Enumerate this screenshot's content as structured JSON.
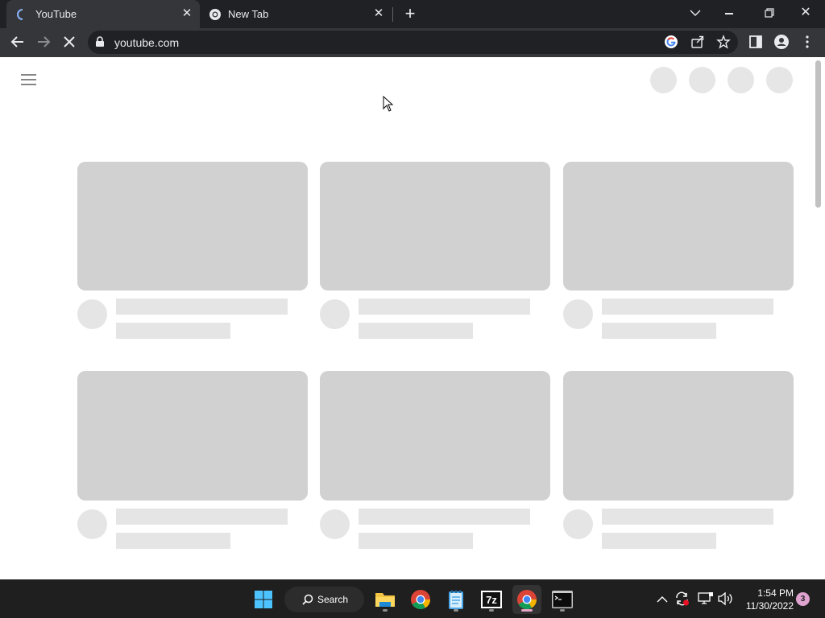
{
  "browser": {
    "tabs": [
      {
        "title": "YouTube",
        "active": true,
        "favicon": "loading-spinner-icon"
      },
      {
        "title": "New Tab",
        "active": false,
        "favicon": "chrome-icon"
      }
    ],
    "new_tab_icon": "plus-icon",
    "window_controls": [
      "tab-search-icon",
      "minimize-icon",
      "restore-icon",
      "close-icon"
    ],
    "url": "youtube.com",
    "toolbar_icons": [
      "back-arrow-icon",
      "forward-arrow-icon",
      "stop-loading-icon",
      "lock-icon",
      "google-icon",
      "share-icon",
      "bookmark-star-icon",
      "side-panel-icon",
      "profile-icon",
      "menu-kebab-icon"
    ]
  },
  "page": {
    "state": "loading skeleton",
    "colors": {
      "thumbnail": "#d1d1d1",
      "placeholder": "#e5e5e5",
      "background": "#ffffff"
    }
  },
  "taskbar": {
    "search_label": "Search",
    "apps": [
      "start-windows-icon",
      "file-explorer-icon",
      "chrome-icon",
      "notepad-icon",
      "7zip-icon",
      "chrome-active-icon",
      "terminal-icon"
    ],
    "tray_icons": [
      "chevron-up-icon",
      "sync-icon",
      "network-icon",
      "volume-icon"
    ],
    "time": "1:54 PM",
    "date": "11/30/2022",
    "notification_count": "3"
  }
}
